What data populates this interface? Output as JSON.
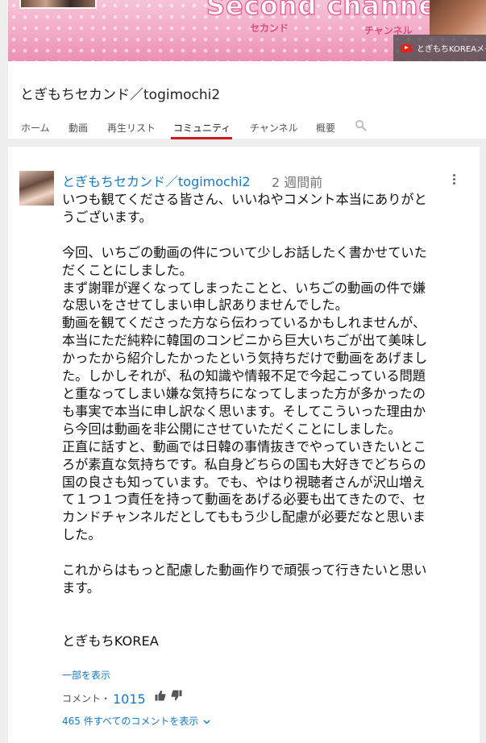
{
  "banner": {
    "title": "Second channel",
    "sub_left": "セカンド",
    "sub_right": "チャンネル",
    "link_text": "とぎもちKOREAメイ"
  },
  "channel": {
    "name": "とぎもちセカンド／togimochi2",
    "tabs": [
      {
        "label": "ホーム"
      },
      {
        "label": "動画"
      },
      {
        "label": "再生リスト"
      },
      {
        "label": "コミュニティ",
        "active": true
      },
      {
        "label": "チャンネル"
      },
      {
        "label": "概要"
      }
    ]
  },
  "post": {
    "author": "とぎもちセカンド／togimochi2",
    "ago": "2 週間前",
    "text": "いつも観てくださる皆さん、いいねやコメント本当にありがとうございます。\n\n今回、いちごの動画の件について少しお話したく書かせていただくことにしました。\nまず謝罪が遅くなってしまったことと、いちごの動画の件で嫌な思いをさせてしまい申し訳ありませんでした。\n動画を観てくださった方なら伝わっているかもしれませんが、本当にただ純粋に韓国のコンビニから巨大いちごが出て美味しかったから紹介したかったという気持ちだけで動画をあげました。しかしそれが、私の知識や情報不足で今起こっている問題と重なってしまい嫌な気持ちになってしまった方が多かったのも事実で本当に申し訳なく思います。そしてこういった理由から今回は動画を非公開にさせていただくことにしました。\n正直に話すと、動画では日韓の事情抜きでやっていきたいところが素直な気持ちです。私自身どちらの国も大好きでどちらの国の良さも知っています。でも、やはり視聴者さんが沢山増えて１つ１つ責任を持って動画をあげる必要も出てきたので、セカンドチャンネルだとしてももう少し配慮が必要だなと思いました。\n\nこれからはもっと配慮した動画作りで頑張って行きたいと思います。\n\n\nとぎもちKOREA",
    "show_part": "一部を表示",
    "comment_label": "コメント・",
    "comment_count": "1015",
    "view_all": "465 件すべてのコメントを表示"
  },
  "colors": {
    "accent_red": "#cc181e",
    "link_blue": "#167ac6",
    "banner_pink": "#f3aac6"
  },
  "icons": [
    "search-icon",
    "more-vert-icon",
    "thumb-up-icon",
    "thumb-down-icon",
    "chevron-down-icon",
    "youtube-icon"
  ]
}
